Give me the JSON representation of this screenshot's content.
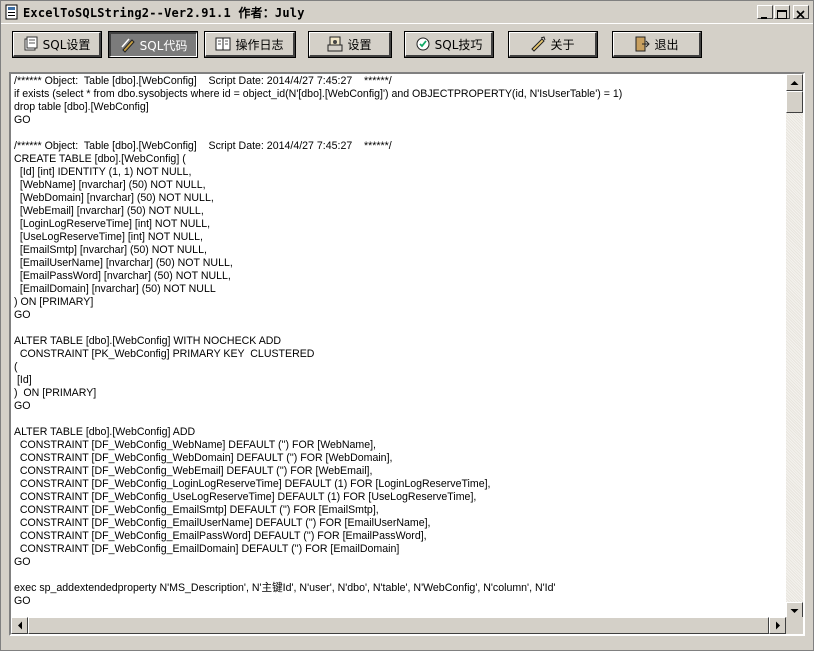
{
  "window": {
    "title": "ExcelToSQLString2--Ver2.91.1    作者：July"
  },
  "toolbar": {
    "buttons": [
      {
        "label": "SQL设置",
        "icon": "sql-settings-icon",
        "active": false
      },
      {
        "label": "SQL代码",
        "icon": "code-icon",
        "active": true
      },
      {
        "label": "操作日志",
        "icon": "log-icon",
        "active": false
      },
      {
        "label": "设置",
        "icon": "settings-icon",
        "active": false
      },
      {
        "label": "SQL技巧",
        "icon": "tips-icon",
        "active": false
      },
      {
        "label": "关于",
        "icon": "about-icon",
        "active": false
      },
      {
        "label": "退出",
        "icon": "exit-icon",
        "active": false
      }
    ]
  },
  "editor": {
    "lines": [
      "/****** Object:  Table [dbo].[WebConfig]    Script Date: 2014/4/27 7:45:27    ******/",
      "if exists (select * from dbo.sysobjects where id = object_id(N'[dbo].[WebConfig]') and OBJECTPROPERTY(id, N'IsUserTable') = 1)",
      "drop table [dbo].[WebConfig]",
      "GO",
      "",
      "/****** Object:  Table [dbo].[WebConfig]    Script Date: 2014/4/27 7:45:27    ******/",
      "CREATE TABLE [dbo].[WebConfig] (",
      "  [Id] [int] IDENTITY (1, 1) NOT NULL,",
      "  [WebName] [nvarchar] (50) NOT NULL,",
      "  [WebDomain] [nvarchar] (50) NOT NULL,",
      "  [WebEmail] [nvarchar] (50) NOT NULL,",
      "  [LoginLogReserveTime] [int] NOT NULL,",
      "  [UseLogReserveTime] [int] NOT NULL,",
      "  [EmailSmtp] [nvarchar] (50) NOT NULL,",
      "  [EmailUserName] [nvarchar] (50) NOT NULL,",
      "  [EmailPassWord] [nvarchar] (50) NOT NULL,",
      "  [EmailDomain] [nvarchar] (50) NOT NULL",
      ") ON [PRIMARY]",
      "GO",
      "",
      "ALTER TABLE [dbo].[WebConfig] WITH NOCHECK ADD",
      "  CONSTRAINT [PK_WebConfig] PRIMARY KEY  CLUSTERED",
      "(",
      " [Id]",
      ")  ON [PRIMARY]",
      "GO",
      "",
      "ALTER TABLE [dbo].[WebConfig] ADD",
      "  CONSTRAINT [DF_WebConfig_WebName] DEFAULT ('') FOR [WebName],",
      "  CONSTRAINT [DF_WebConfig_WebDomain] DEFAULT ('') FOR [WebDomain],",
      "  CONSTRAINT [DF_WebConfig_WebEmail] DEFAULT ('') FOR [WebEmail],",
      "  CONSTRAINT [DF_WebConfig_LoginLogReserveTime] DEFAULT (1) FOR [LoginLogReserveTime],",
      "  CONSTRAINT [DF_WebConfig_UseLogReserveTime] DEFAULT (1) FOR [UseLogReserveTime],",
      "  CONSTRAINT [DF_WebConfig_EmailSmtp] DEFAULT ('') FOR [EmailSmtp],",
      "  CONSTRAINT [DF_WebConfig_EmailUserName] DEFAULT ('') FOR [EmailUserName],",
      "  CONSTRAINT [DF_WebConfig_EmailPassWord] DEFAULT ('') FOR [EmailPassWord],",
      "  CONSTRAINT [DF_WebConfig_EmailDomain] DEFAULT ('') FOR [EmailDomain]",
      "GO",
      "",
      "exec sp_addextendedproperty N'MS_Description', N'主键Id', N'user', N'dbo', N'table', N'WebConfig', N'column', N'Id'",
      "GO"
    ]
  }
}
